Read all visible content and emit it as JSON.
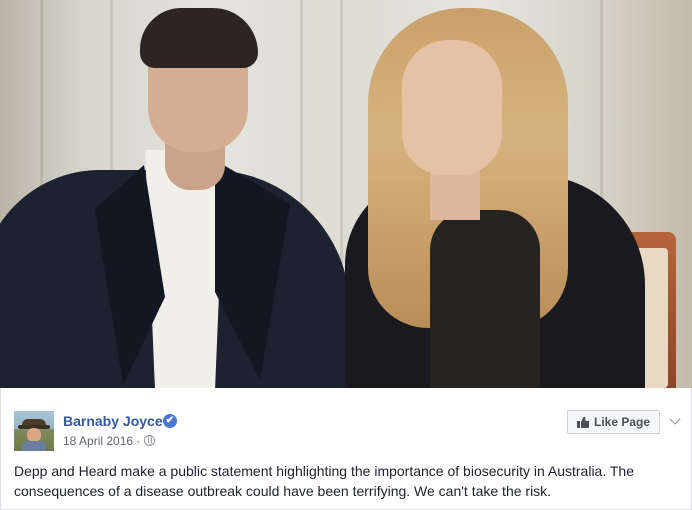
{
  "video": {
    "description_icon": "video-still"
  },
  "post": {
    "page_name": "Barnaby Joyce",
    "verified_mark": "✔",
    "date": "18 April 2016 ·",
    "like_button_label": "Like Page",
    "text": "Depp and Heard make a public statement highlighting the importance of biosecurity in Australia. The consequences of a disease outbreak could have been terrifying. We can't take the risk."
  },
  "colors": {
    "link_blue": "#365899",
    "verified_blue": "#4a76d4",
    "text": "#1d2129",
    "meta": "#616770"
  }
}
